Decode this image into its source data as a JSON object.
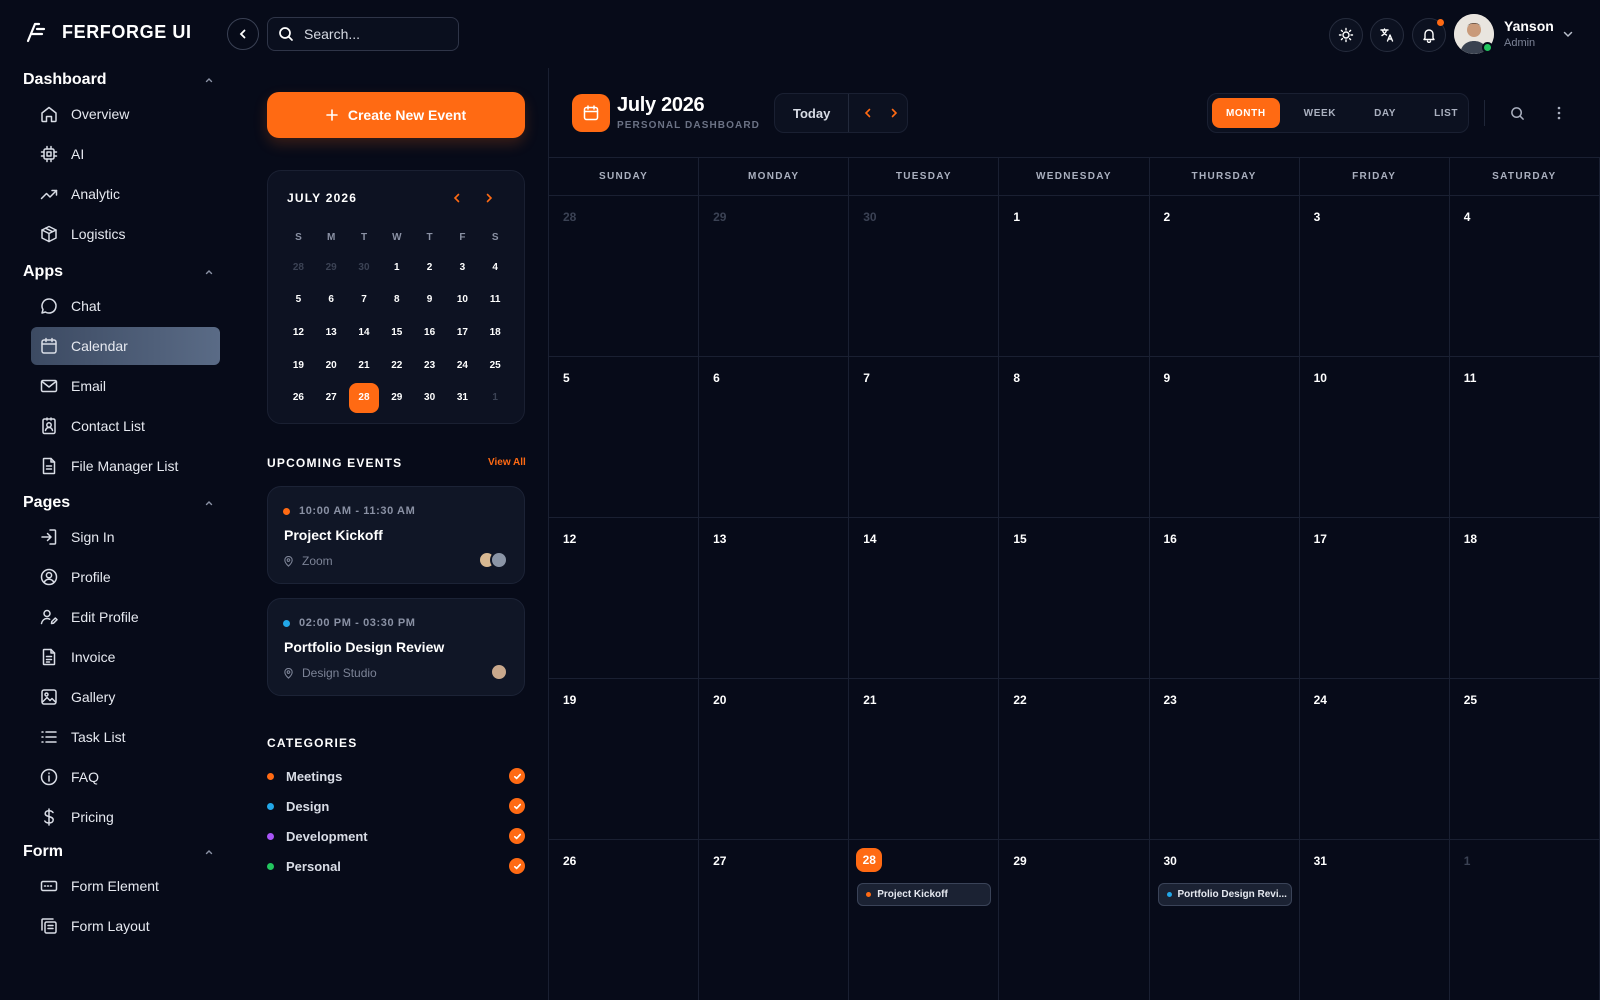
{
  "brand": {
    "name": "FERFORGE UI"
  },
  "search": {
    "placeholder": "Search..."
  },
  "user": {
    "name": "Yanson",
    "role": "Admin"
  },
  "sidebar": {
    "sections": [
      {
        "title": "Dashboard",
        "items": [
          {
            "label": "Overview",
            "icon": "home-icon"
          },
          {
            "label": "AI",
            "icon": "chip-icon"
          },
          {
            "label": "Analytic",
            "icon": "trend-icon"
          },
          {
            "label": "Logistics",
            "icon": "box-icon"
          }
        ]
      },
      {
        "title": "Apps",
        "items": [
          {
            "label": "Chat",
            "icon": "chat-icon"
          },
          {
            "label": "Calendar",
            "icon": "calendar-icon",
            "active": true
          },
          {
            "label": "Email",
            "icon": "mail-icon"
          },
          {
            "label": "Contact List",
            "icon": "contact-icon"
          },
          {
            "label": "File Manager List",
            "icon": "file-icon"
          }
        ]
      },
      {
        "title": "Pages",
        "items": [
          {
            "label": "Sign In",
            "icon": "signin-icon"
          },
          {
            "label": "Profile",
            "icon": "profile-icon"
          },
          {
            "label": "Edit Profile",
            "icon": "edit-profile-icon"
          },
          {
            "label": "Invoice",
            "icon": "invoice-icon"
          },
          {
            "label": "Gallery",
            "icon": "gallery-icon"
          },
          {
            "label": "Task List",
            "icon": "list-icon"
          },
          {
            "label": "FAQ",
            "icon": "info-icon"
          },
          {
            "label": "Pricing",
            "icon": "dollar-icon"
          }
        ]
      },
      {
        "title": "Form",
        "items": [
          {
            "label": "Form Element",
            "icon": "form-element-icon"
          },
          {
            "label": "Form Layout",
            "icon": "form-layout-icon"
          }
        ]
      }
    ]
  },
  "create_event": {
    "label": "Create New Event"
  },
  "mini_calendar": {
    "title": "JULY 2026",
    "weekdays": [
      "S",
      "M",
      "T",
      "W",
      "T",
      "F",
      "S"
    ],
    "days": [
      {
        "d": "28",
        "m": true
      },
      {
        "d": "29",
        "m": true
      },
      {
        "d": "30",
        "m": true
      },
      {
        "d": "1"
      },
      {
        "d": "2"
      },
      {
        "d": "3"
      },
      {
        "d": "4"
      },
      {
        "d": "5"
      },
      {
        "d": "6"
      },
      {
        "d": "7"
      },
      {
        "d": "8"
      },
      {
        "d": "9"
      },
      {
        "d": "10"
      },
      {
        "d": "11"
      },
      {
        "d": "12"
      },
      {
        "d": "13"
      },
      {
        "d": "14"
      },
      {
        "d": "15"
      },
      {
        "d": "16"
      },
      {
        "d": "17"
      },
      {
        "d": "18"
      },
      {
        "d": "19"
      },
      {
        "d": "20"
      },
      {
        "d": "21"
      },
      {
        "d": "22"
      },
      {
        "d": "23"
      },
      {
        "d": "24"
      },
      {
        "d": "25"
      },
      {
        "d": "26"
      },
      {
        "d": "27"
      },
      {
        "d": "28",
        "sel": true
      },
      {
        "d": "29"
      },
      {
        "d": "30"
      },
      {
        "d": "31"
      },
      {
        "d": "1",
        "m": true
      }
    ]
  },
  "upcoming": {
    "title": "UPCOMING EVENTS",
    "view_all": "View All",
    "events": [
      {
        "time": "10:00 AM - 11:30 AM",
        "title": "Project Kickoff",
        "location": "Zoom",
        "color": "#ff6a13"
      },
      {
        "time": "02:00 PM - 03:30 PM",
        "title": "Portfolio Design Review",
        "location": "Design Studio",
        "color": "#22a7e8"
      }
    ]
  },
  "categories": {
    "title": "CATEGORIES",
    "items": [
      {
        "label": "Meetings",
        "color": "#ff6a13"
      },
      {
        "label": "Design",
        "color": "#22a7e8"
      },
      {
        "label": "Development",
        "color": "#a855f7"
      },
      {
        "label": "Personal",
        "color": "#22c55e"
      }
    ]
  },
  "calendar": {
    "title": "July 2026",
    "subtitle": "PERSONAL DASHBOARD",
    "today_label": "Today",
    "views": [
      "MONTH",
      "WEEK",
      "DAY",
      "LIST"
    ],
    "active_view": "MONTH",
    "weekdays": [
      "SUNDAY",
      "MONDAY",
      "TUESDAY",
      "WEDNESDAY",
      "THURSDAY",
      "FRIDAY",
      "SATURDAY"
    ],
    "cells": [
      {
        "d": "28",
        "m": true
      },
      {
        "d": "29",
        "m": true
      },
      {
        "d": "30",
        "m": true
      },
      {
        "d": "1"
      },
      {
        "d": "2"
      },
      {
        "d": "3"
      },
      {
        "d": "4"
      },
      {
        "d": "5"
      },
      {
        "d": "6"
      },
      {
        "d": "7"
      },
      {
        "d": "8"
      },
      {
        "d": "9"
      },
      {
        "d": "10"
      },
      {
        "d": "11"
      },
      {
        "d": "12"
      },
      {
        "d": "13"
      },
      {
        "d": "14"
      },
      {
        "d": "15"
      },
      {
        "d": "16"
      },
      {
        "d": "17"
      },
      {
        "d": "18"
      },
      {
        "d": "19"
      },
      {
        "d": "20"
      },
      {
        "d": "21"
      },
      {
        "d": "22"
      },
      {
        "d": "23"
      },
      {
        "d": "24"
      },
      {
        "d": "25"
      },
      {
        "d": "26"
      },
      {
        "d": "27"
      },
      {
        "d": "28",
        "today": true,
        "event": {
          "label": "Project Kickoff",
          "color": "#ff6a13"
        }
      },
      {
        "d": "29"
      },
      {
        "d": "30",
        "event": {
          "label": "Portfolio Design Revi...",
          "color": "#22a7e8"
        }
      },
      {
        "d": "31"
      },
      {
        "d": "1",
        "m": true
      }
    ]
  }
}
